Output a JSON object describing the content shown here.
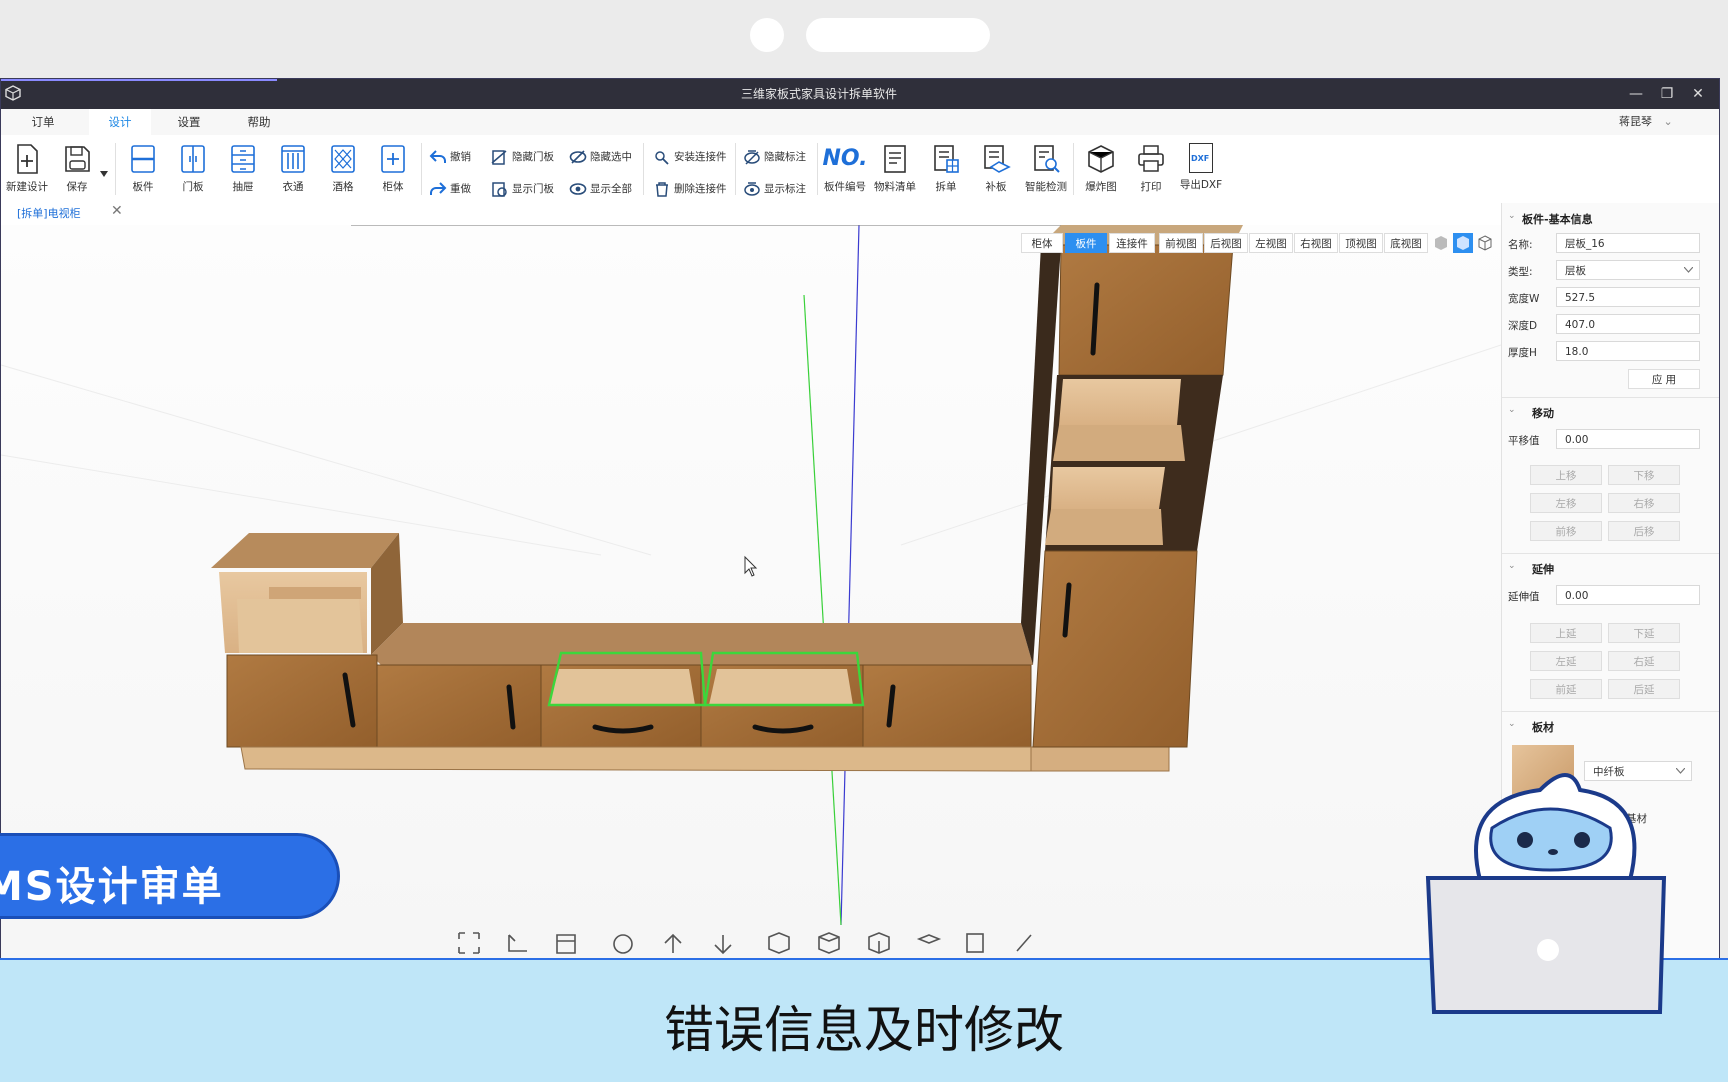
{
  "window": {
    "title": "三维家板式家具设计拆单软件",
    "minimize": "—",
    "restore": "❐",
    "close": "✕"
  },
  "menu": {
    "tabs": [
      "订单",
      "设计",
      "设置",
      "帮助"
    ],
    "active": "设计",
    "user": "蒋昆琴",
    "user_caret": "⌄"
  },
  "toolbar": {
    "big_buttons_left": [
      {
        "label": "新建设计",
        "icon": "new-file-icon"
      },
      {
        "label": "保存",
        "icon": "save-icon"
      },
      {
        "label": "板件",
        "icon": "panel-icon"
      },
      {
        "label": "门板",
        "icon": "door-icon"
      },
      {
        "label": "抽屉",
        "icon": "drawer-icon"
      },
      {
        "label": "衣通",
        "icon": "rail-icon"
      },
      {
        "label": "酒格",
        "icon": "wine-rack-icon"
      },
      {
        "label": "柜体",
        "icon": "cabinet-icon"
      }
    ],
    "small_buttons": [
      {
        "label": "撤销",
        "icon": "undo-icon"
      },
      {
        "label": "重做",
        "icon": "redo-icon"
      },
      {
        "label": "隐藏门板",
        "icon": "hide-door-icon"
      },
      {
        "label": "显示门板",
        "icon": "show-door-icon"
      },
      {
        "label": "隐藏选中",
        "icon": "hide-selected-icon"
      },
      {
        "label": "显示全部",
        "icon": "show-all-icon"
      },
      {
        "label": "安装连接件",
        "icon": "install-connector-icon"
      },
      {
        "label": "删除连接件",
        "icon": "delete-connector-icon"
      },
      {
        "label": "隐藏标注",
        "icon": "hide-annotation-icon"
      },
      {
        "label": "显示标注",
        "icon": "show-annotation-icon"
      }
    ],
    "big_buttons_right": [
      {
        "label": "板件编号",
        "icon": "numbering-icon",
        "glyph": "NO."
      },
      {
        "label": "物料清单",
        "icon": "bom-icon"
      },
      {
        "label": "拆单",
        "icon": "split-order-icon"
      },
      {
        "label": "补板",
        "icon": "patch-panel-icon"
      },
      {
        "label": "智能检测",
        "icon": "smart-check-icon"
      },
      {
        "label": "爆炸图",
        "icon": "explode-icon"
      },
      {
        "label": "打印",
        "icon": "print-icon"
      },
      {
        "label": "导出DXF",
        "icon": "dxf-export-icon",
        "glyph": "DXF"
      }
    ]
  },
  "doc_tab": {
    "label": "[拆单]电视柜",
    "close": "✕"
  },
  "view_tabs": {
    "mode": [
      "柜体",
      "板件",
      "连接件"
    ],
    "active": "板件",
    "views": [
      "前视图",
      "后视图",
      "左视图",
      "右视图",
      "顶视图",
      "底视图"
    ]
  },
  "panel": {
    "basic": {
      "title": "板件-基本信息",
      "name_label": "名称:",
      "name_value": "层板_16",
      "type_label": "类型:",
      "type_value": "层板",
      "width_label": "宽度W",
      "width_value": "527.5",
      "depth_label": "深度D",
      "depth_value": "407.0",
      "thick_label": "厚度H",
      "thick_value": "18.0",
      "apply": "应  用"
    },
    "move": {
      "title": "移动",
      "offset_label": "平移值",
      "offset_value": "0.00",
      "buttons": [
        "上移",
        "下移",
        "左移",
        "右移",
        "前移",
        "后移"
      ]
    },
    "extend": {
      "title": "延伸",
      "value_label": "延伸值",
      "value": "0.00",
      "buttons": [
        "上延",
        "下延",
        "左延",
        "右延",
        "前延",
        "后延"
      ]
    },
    "material": {
      "title": "板材",
      "material_value": "中纤板",
      "substrate_label": "基材"
    }
  },
  "overlay": {
    "banner": "MS设计审单",
    "subtitle": "错误信息及时修改"
  },
  "colors": {
    "accent_blue": "#2d8ff0",
    "selection_green": "#3cd63c",
    "wood": "#a8733d",
    "banner_blue": "#2b6fe6",
    "subtitle_bg": "#bfe6f8"
  }
}
